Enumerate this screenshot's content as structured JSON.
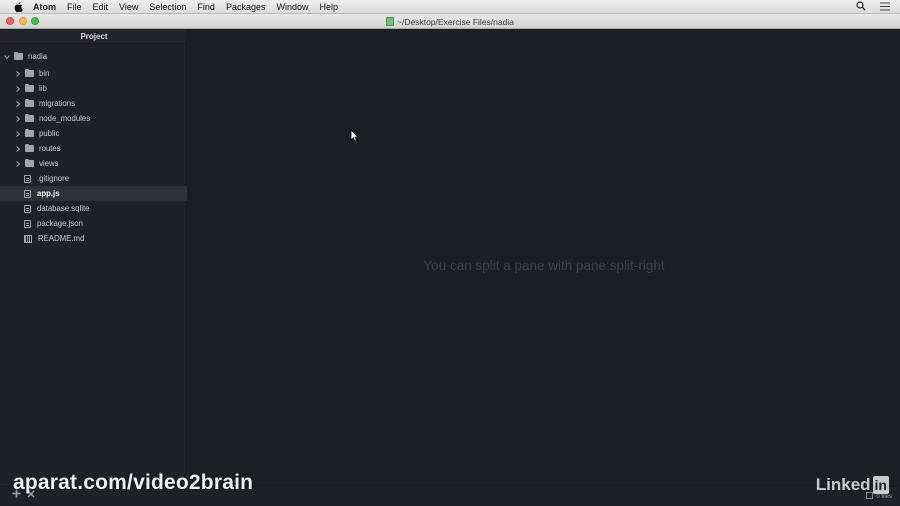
{
  "menubar": {
    "app_name": "Atom",
    "items": [
      "File",
      "Edit",
      "View",
      "Selection",
      "Find",
      "Packages",
      "Window",
      "Help"
    ]
  },
  "window": {
    "title": "~/Desktop/Exercise Files/nadia"
  },
  "treeview": {
    "header": "Project",
    "root": "nadia",
    "folders": [
      "bin",
      "lib",
      "migrations",
      "node_modules",
      "public",
      "routes",
      "views"
    ],
    "files": [
      ".gitignore",
      "app.js",
      "database.sqlite",
      "package.json",
      "README.md"
    ],
    "selected": "app.js"
  },
  "editor": {
    "hint": "You can split a pane with pane:split-right"
  },
  "statusbar": {
    "right_label": "0 files"
  },
  "watermarks": {
    "left": "aparat.com/video2brain",
    "right_word": "Linked",
    "right_badge": "in"
  },
  "colors": {
    "background": "#1d2025",
    "tree_bg": "#1e2127",
    "editor_bg": "#1b1e23",
    "selected_row": "#2c313a",
    "hint_text": "#3c414b"
  }
}
